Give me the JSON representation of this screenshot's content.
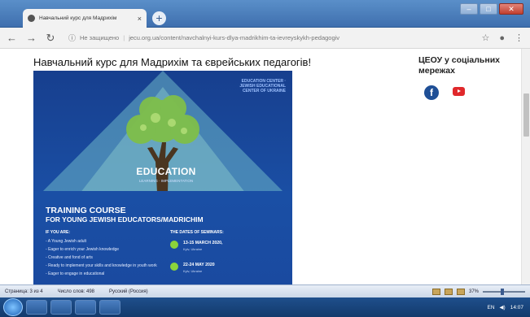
{
  "browser": {
    "tab_title": "Навчальний курс для Мадрихім",
    "tab_close": "×",
    "new_tab": "+",
    "security": "Не защищено",
    "url": "jecu.org.ua/content/navchalnyi-kurs-dlya-madrikhim-ta-ievreyskykh-pedagogiv"
  },
  "page": {
    "heading": "Навчальний курс для Мадрихім та єврейських педагогів!",
    "social_title": "ЦЕОУ у соціальних мережах",
    "facebook_glyph": "f"
  },
  "poster": {
    "logo": "EDUCATION CENTER · JEWISH EDUCATIONAL CENTER OF UKRAINE",
    "education": "EDUCATION",
    "education_sub": "LEARNING · IMPLEMENTATION",
    "title_line1": "TRAINING COURSE",
    "title_line2": "FOR YOUNG JEWISH EDUCATORS/MADRICHIM",
    "if_you_are": "IF YOU ARE:",
    "bullets": [
      "A Young Jewish adult",
      "Eager to enrich your Jewish knowledge",
      "Creative and fond of arts",
      "Ready to implement your skills and knowledge in youth work",
      "Eager to engage in educational"
    ],
    "dates_title": "THE DATES OF SEMINARS:",
    "date1": "13-15 MARCH 2020,",
    "date1_place": "Kyiv, Ukraine",
    "date2": "22-24 MAY 2020",
    "date2_place": "Kyiv, Ukraine"
  },
  "statusbar": {
    "page": "Страница: 3 из 4",
    "words": "Число слов: 498",
    "lang": "Русский (Россия)",
    "zoom": "37%"
  },
  "taskbar": {
    "lang": "EN",
    "time": "14:07"
  },
  "colors": {
    "poster_bg": "#1a4fa5",
    "bullet_dot": "#8bd33b",
    "facebook": "#1f4f96",
    "youtube": "#e0282b"
  }
}
